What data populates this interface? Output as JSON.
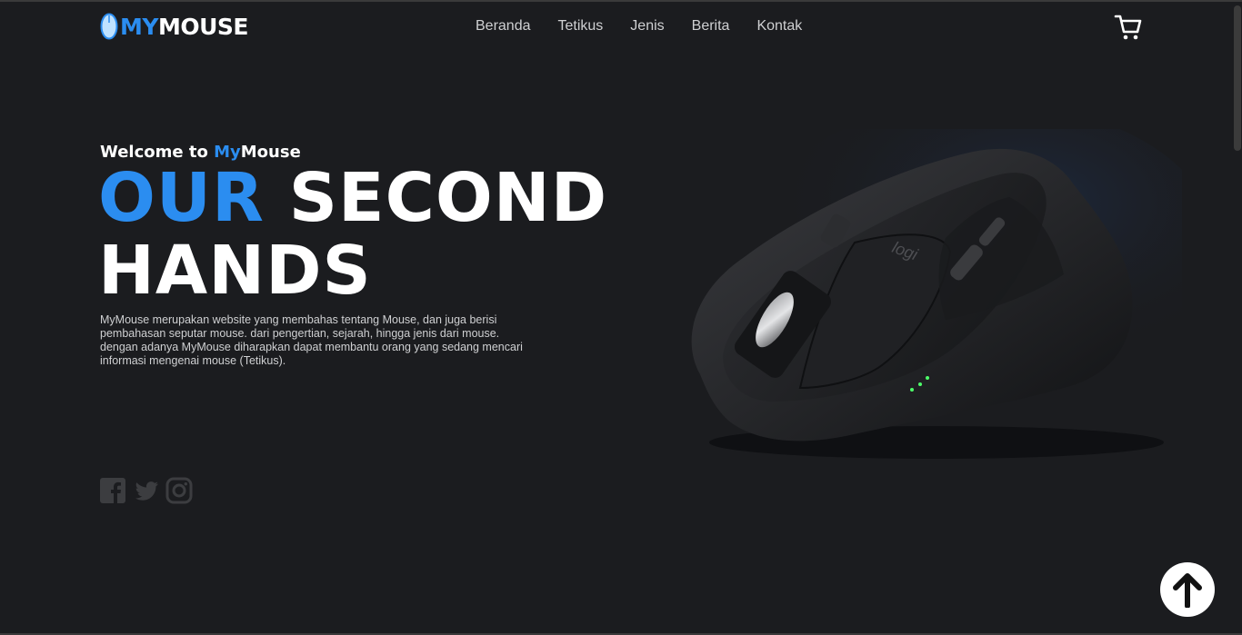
{
  "brand": {
    "my": "MY",
    "mouse": "MOUSE"
  },
  "nav": {
    "items": [
      "Beranda",
      "Tetikus",
      "Jenis",
      "Berita",
      "Kontak"
    ]
  },
  "hero": {
    "welcome_prefix": "Welcome to ",
    "welcome_my": "My",
    "welcome_mouse": "Mouse",
    "headline_accent": "OUR",
    "headline_rest_1": " SECOND",
    "headline_line_2": "HANDS",
    "description": "MyMouse merupakan website yang membahas tentang Mouse, dan juga berisi pembahasan seputar mouse. dari pengertian, sejarah, hingga jenis dari mouse. dengan adanya MyMouse diharapkan dapat membantu orang yang sedang mencari informasi mengenai mouse (Tetikus)."
  },
  "product": {
    "logo_text": "logi"
  },
  "social": [
    "facebook-icon",
    "twitter-icon",
    "instagram-icon"
  ],
  "icons": {
    "cart": "cart-icon",
    "back_to_top": "arrow-up-icon"
  },
  "colors": {
    "background": "#1b1c1f",
    "accent": "#2b8df0",
    "text": "#ffffff",
    "muted": "#cfd0d2"
  }
}
